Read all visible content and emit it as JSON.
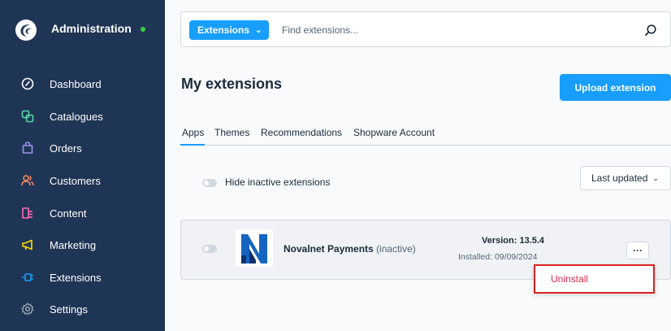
{
  "sidebar": {
    "brand_title": "Administration",
    "items": [
      {
        "label": "Dashboard",
        "icon": "dashboard-icon",
        "color": "#ffffff"
      },
      {
        "label": "Catalogues",
        "icon": "catalogue-icon",
        "color": "#57d9a3"
      },
      {
        "label": "Orders",
        "icon": "orders-icon",
        "color": "#a092f0"
      },
      {
        "label": "Customers",
        "icon": "customers-icon",
        "color": "#f88962"
      },
      {
        "label": "Content",
        "icon": "content-icon",
        "color": "#ff68b4"
      },
      {
        "label": "Marketing",
        "icon": "marketing-icon",
        "color": "#ffd700"
      },
      {
        "label": "Extensions",
        "icon": "extensions-icon",
        "color": "#189eff"
      },
      {
        "label": "Settings",
        "icon": "settings-icon",
        "color": "#9aa8b5"
      }
    ]
  },
  "search": {
    "type_label": "Extensions",
    "placeholder": "Find extensions..."
  },
  "header": {
    "title": "My extensions",
    "upload_label": "Upload extension"
  },
  "tabs": [
    "Apps",
    "Themes",
    "Recommendations",
    "Shopware Account"
  ],
  "filters": {
    "hide_inactive_label": "Hide inactive extensions",
    "sort_label": "Last updated"
  },
  "extension": {
    "name": "Novalnet Payments",
    "status": "(inactive)",
    "version": "Version: 13.5.4",
    "installed": "Installed: 09/09/2024",
    "more_label": "···"
  },
  "context_menu": {
    "uninstall_label": "Uninstall"
  },
  "colors": {
    "sidebar_bg": "#1f3555",
    "accent": "#189eff",
    "danger": "#de294c",
    "status_online": "#37d046"
  }
}
